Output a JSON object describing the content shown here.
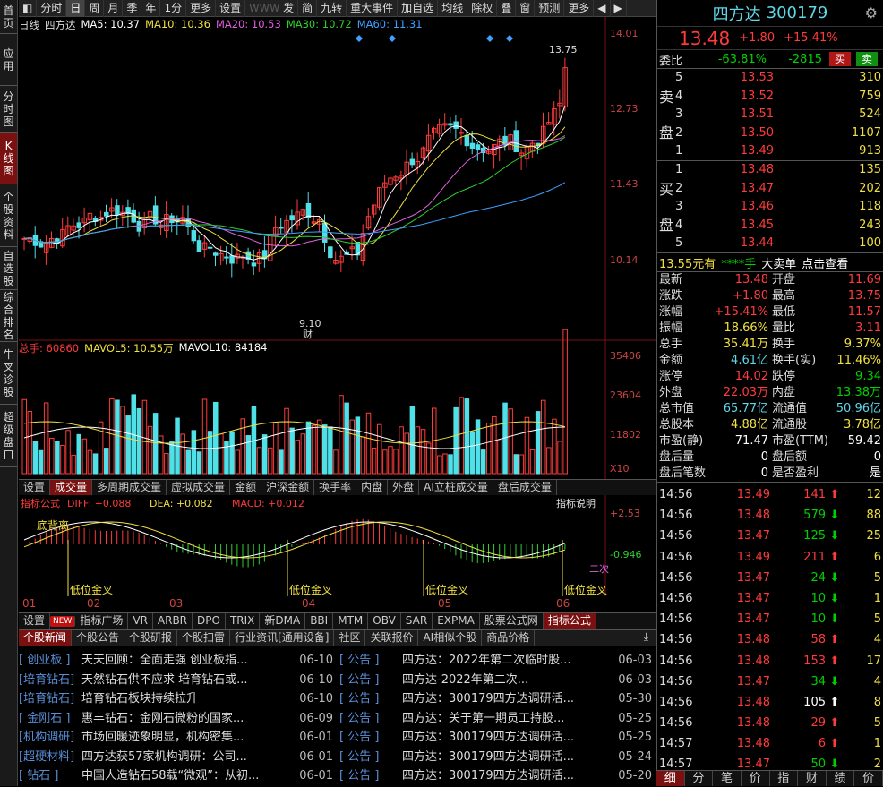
{
  "left_nav": [
    {
      "label": "首页",
      "active": false
    },
    {
      "label": "应用",
      "active": false
    },
    {
      "label": "分时图",
      "active": false
    },
    {
      "label": "K线图",
      "active": true
    },
    {
      "label": "个股资料",
      "active": false
    },
    {
      "label": "自选股",
      "active": false
    },
    {
      "label": "综合排名",
      "active": false
    },
    {
      "label": "牛叉诊股",
      "active": false
    },
    {
      "label": "超级盘口",
      "active": false
    }
  ],
  "toolbar": {
    "left_items": [
      "分时",
      "日",
      "周",
      "月",
      "季",
      "年",
      "1分",
      "更多",
      "设置"
    ],
    "right_items": [
      "发",
      "简",
      "九转",
      "重大事件",
      "加自选",
      "均线",
      "除权",
      "叠",
      "窗",
      "预测",
      "更多"
    ],
    "active_item": "日",
    "watermark": "www.goo.cn"
  },
  "ma_legend": {
    "period": "日线",
    "stock": "四方达",
    "ma5": "MA5: 10.37",
    "ma10": "MA10: 10.36",
    "ma20": "MA20: 10.53",
    "ma30": "MA30: 10.72",
    "ma60": "MA60: 11.31",
    "ma5_color": "#ffffff",
    "ma10_color": "#f0e040",
    "ma20_color": "#e060e0",
    "ma30_color": "#30d030",
    "ma60_color": "#40a0ff"
  },
  "price_axis": [
    "14.01",
    "12.73",
    "11.43",
    "10.14"
  ],
  "price_annotations": {
    "high": "13.75",
    "low": "9.10",
    "low_marker": "财"
  },
  "vol_legend": {
    "total": "总手: 60860",
    "mavol5": "MAVOL5: 10.55万",
    "mavol10": "MAVOL10: 84184"
  },
  "vol_axis": [
    "35406",
    "23604",
    "11802"
  ],
  "vol_unit": "X10",
  "indicator_tabs": [
    "设置",
    "成交量",
    "多周期成交量",
    "虚拟成交量",
    "金额",
    "沪深金额",
    "换手率",
    "内盘",
    "外盘",
    "AI立桩成交量",
    "盘后成交量"
  ],
  "indicator_active": "成交量",
  "macd_legend": {
    "name": "指标公式",
    "diff": "DIFF: +0.088",
    "dea": "DEA: +0.082",
    "macd": "MACD: +0.012",
    "help": "指标说明"
  },
  "macd_axis": [
    "+2.53",
    "-0.946"
  ],
  "macd_annotations": {
    "divergence": "底背离",
    "golden_cross": "低位金叉",
    "second": "二次"
  },
  "date_axis": [
    "01",
    "02",
    "03",
    "04",
    "05",
    "06"
  ],
  "formula_tabs": [
    "设置",
    "NEW",
    "指标广场",
    "VR",
    "ARBR",
    "DPO",
    "TRIX",
    "新DMA",
    "BBI",
    "MTM",
    "OBV",
    "SAR",
    "EXPMA",
    "股票公式网",
    "指标公式"
  ],
  "formula_active": "指标公式",
  "news_tabs": [
    "个股新闻",
    "个股公告",
    "个股研报",
    "个股扫雷",
    "行业资讯[通用设备]",
    "社区",
    "关联报价",
    "AI相似个股",
    "商品价格"
  ],
  "news_active": "个股新闻",
  "news_left": [
    {
      "tag": "[ 创业板 ]",
      "title": "天天回顾：全面走强 创业板指...",
      "date": "06-10"
    },
    {
      "tag": "[培育钻石]",
      "title": "天然钻石供不应求 培育钻石或...",
      "date": "06-10"
    },
    {
      "tag": "[培育钻石]",
      "title": "培育钻石板块持续拉升",
      "date": "06-10"
    },
    {
      "tag": "[ 金刚石 ]",
      "title": "惠丰钻石：金刚石微粉的国家...",
      "date": "06-09"
    },
    {
      "tag": "[机构调研]",
      "title": "市场回暖迹象明显，机构密集...",
      "date": "06-01"
    },
    {
      "tag": "[超硬材料]",
      "title": "四方达获57家机构调研：公司...",
      "date": "06-01"
    },
    {
      "tag": "[ 钻石 ]",
      "title": "中国人造钻石58载“微观”：从初...",
      "date": "06-01"
    }
  ],
  "news_right": [
    {
      "tag": "[ 公告 ]",
      "title": "四方达：2022年第二次临时股...",
      "date": "06-03"
    },
    {
      "tag": "[ 公告 ]",
      "title": "四方达-2022年第二次...",
      "date": "06-03"
    },
    {
      "tag": "[ 公告 ]",
      "title": "四方达：300179四方达调研活...",
      "date": "05-30"
    },
    {
      "tag": "[ 公告 ]",
      "title": "四方达：关于第一期员工持股...",
      "date": "05-25"
    },
    {
      "tag": "[ 公告 ]",
      "title": "四方达：300179四方达调研活...",
      "date": "05-25"
    },
    {
      "tag": "[ 公告 ]",
      "title": "四方达：300179四方达调研活...",
      "date": "05-24"
    },
    {
      "tag": "[ 公告 ]",
      "title": "四方达：300179四方达调研活...",
      "date": "05-20"
    }
  ],
  "quote": {
    "name": "四方达",
    "code": "300179",
    "price": "13.48",
    "change": "+1.80",
    "change_pct": "+15.41%",
    "weibi_label": "委比",
    "weibi": "-63.81%",
    "weicha": "-2815",
    "buy_btn": "买",
    "sell_btn": "卖"
  },
  "asks": [
    {
      "lv": "5",
      "price": "13.53",
      "vol": "310"
    },
    {
      "lv": "4",
      "price": "13.52",
      "vol": "759"
    },
    {
      "lv": "3",
      "price": "13.51",
      "vol": "524"
    },
    {
      "lv": "2",
      "price": "13.50",
      "vol": "1107"
    },
    {
      "lv": "1",
      "price": "13.49",
      "vol": "913"
    }
  ],
  "ask_label": [
    "卖",
    "盘"
  ],
  "bids": [
    {
      "lv": "1",
      "price": "13.48",
      "vol": "135"
    },
    {
      "lv": "2",
      "price": "13.47",
      "vol": "202"
    },
    {
      "lv": "3",
      "price": "13.46",
      "vol": "118"
    },
    {
      "lv": "4",
      "price": "13.45",
      "vol": "243"
    },
    {
      "lv": "5",
      "price": "13.44",
      "vol": "100"
    }
  ],
  "bid_label": [
    "买",
    "盘"
  ],
  "big_order": {
    "price": "13.55元有",
    "stars": "****手",
    "label": "大卖单",
    "link": "点击查看"
  },
  "stats": [
    [
      "最新",
      "13.48",
      "red",
      "开盘",
      "11.69",
      "red"
    ],
    [
      "涨跌",
      "+1.80",
      "red",
      "最高",
      "13.75",
      "red"
    ],
    [
      "涨幅",
      "+15.41%",
      "red",
      "最低",
      "11.57",
      "red"
    ],
    [
      "振幅",
      "18.66%",
      "yellow",
      "量比",
      "3.11",
      "red"
    ],
    [
      "总手",
      "35.41万",
      "yellow",
      "换手",
      "9.37%",
      "yellow"
    ],
    [
      "金额",
      "4.61亿",
      "cyan",
      "换手(实)",
      "11.46%",
      "yellow"
    ],
    [
      "涨停",
      "14.02",
      "red",
      "跌停",
      "9.34",
      "green"
    ],
    [
      "外盘",
      "22.03万",
      "red",
      "内盘",
      "13.38万",
      "green"
    ],
    [
      "总市值",
      "65.77亿",
      "cyan",
      "流通值",
      "50.96亿",
      "cyan"
    ],
    [
      "总股本",
      "4.88亿",
      "yellow",
      "流通股",
      "3.78亿",
      "yellow"
    ],
    [
      "市盈(静)",
      "71.47",
      "white",
      "市盈(TTM)",
      "59.42",
      "white"
    ],
    [
      "盘后量",
      "0",
      "white",
      "盘后额",
      "0",
      "white"
    ],
    [
      "盘后笔数",
      "0",
      "white",
      "是否盈利",
      "是",
      "white"
    ]
  ],
  "ticks": [
    {
      "time": "14:56",
      "price": "13.49",
      "pcol": "red",
      "vol": "141",
      "dir": "up",
      "n": "12"
    },
    {
      "time": "14:56",
      "price": "13.48",
      "pcol": "red",
      "vol": "579",
      "dir": "down",
      "n": "88"
    },
    {
      "time": "14:56",
      "price": "13.47",
      "pcol": "red",
      "vol": "125",
      "dir": "down",
      "n": "25"
    },
    {
      "time": "14:56",
      "price": "13.49",
      "pcol": "red",
      "vol": "211",
      "dir": "up",
      "n": "6"
    },
    {
      "time": "14:56",
      "price": "13.47",
      "pcol": "red",
      "vol": "24",
      "dir": "down",
      "n": "5"
    },
    {
      "time": "14:56",
      "price": "13.47",
      "pcol": "red",
      "vol": "10",
      "dir": "down",
      "n": "1"
    },
    {
      "time": "14:56",
      "price": "13.47",
      "pcol": "red",
      "vol": "10",
      "dir": "down",
      "n": "5"
    },
    {
      "time": "14:56",
      "price": "13.48",
      "pcol": "red",
      "vol": "58",
      "dir": "up",
      "n": "4"
    },
    {
      "time": "14:56",
      "price": "13.48",
      "pcol": "red",
      "vol": "153",
      "dir": "up",
      "n": "17"
    },
    {
      "time": "14:56",
      "price": "13.47",
      "pcol": "red",
      "vol": "34",
      "dir": "down",
      "n": "4"
    },
    {
      "time": "14:56",
      "price": "13.48",
      "pcol": "red",
      "vol": "105",
      "dir": "neutral",
      "n": "8"
    },
    {
      "time": "14:56",
      "price": "13.48",
      "pcol": "red",
      "vol": "29",
      "dir": "up",
      "n": "5"
    },
    {
      "time": "14:57",
      "price": "13.48",
      "pcol": "red",
      "vol": "6",
      "dir": "up",
      "n": "1"
    },
    {
      "time": "14:57",
      "price": "13.47",
      "pcol": "red",
      "vol": "50",
      "dir": "down",
      "n": "2"
    }
  ],
  "right_tabs": [
    "细",
    "分",
    "笔",
    "价",
    "指",
    "财",
    "绩",
    "价"
  ],
  "right_active": "细",
  "colors": {
    "up": "#ff3b3b",
    "down": "#4fe0e8",
    "bg": "#000000",
    "accent": "#7a1010"
  }
}
